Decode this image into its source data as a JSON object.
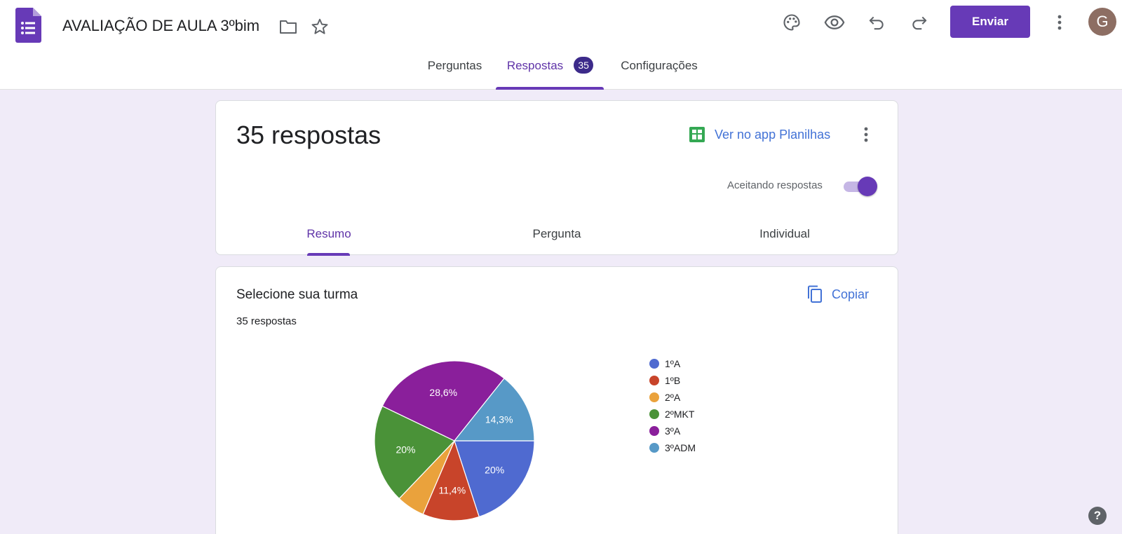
{
  "header": {
    "title": "AVALIAÇÃO DE AULA 3ºbim",
    "send_label": "Enviar",
    "avatar_letter": "G",
    "icons": [
      "palette-icon",
      "eye-icon",
      "undo-icon",
      "redo-icon",
      "more-vert-icon"
    ]
  },
  "tabs": [
    {
      "label": "Perguntas"
    },
    {
      "label": "Respostas",
      "badge": "35",
      "active": true
    },
    {
      "label": "Configurações"
    }
  ],
  "summary": {
    "count_label": "35 respostas",
    "sheets_label": "Ver no app Planilhas",
    "accepting_label": "Aceitando respostas",
    "accepting": true,
    "subtabs": [
      {
        "label": "Resumo",
        "active": true
      },
      {
        "label": "Pergunta"
      },
      {
        "label": "Individual"
      }
    ]
  },
  "question": {
    "title": "Selecione sua turma",
    "count": "35 respostas",
    "copy_label": "Copiar"
  },
  "chart_data": {
    "type": "pie",
    "categories": [
      "1ºA",
      "1ºB",
      "2ºA",
      "2ºMKT",
      "3ºA",
      "3ºADM"
    ],
    "values": [
      7,
      4,
      2,
      7,
      10,
      5
    ],
    "labels": [
      "20%",
      "11,4%",
      "",
      "20%",
      "28,6%",
      "14,3%"
    ],
    "colors": [
      "#4f6ad0",
      "#c8442a",
      "#eaa23c",
      "#4a9238",
      "#8a1f9b",
      "#5799c7"
    ],
    "legend_position": "right"
  },
  "help_label": "?"
}
